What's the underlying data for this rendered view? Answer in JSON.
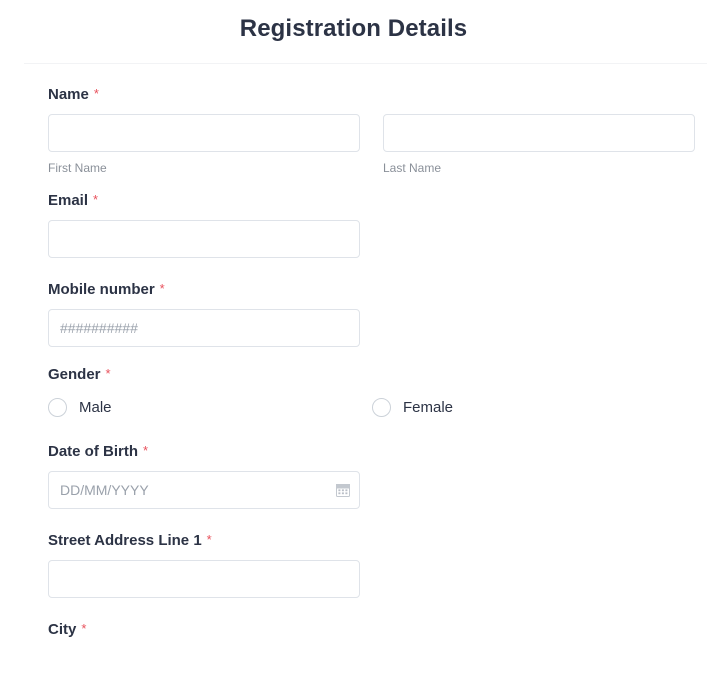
{
  "header": {
    "title": "Registration Details"
  },
  "required_marker": "*",
  "colors": {
    "required_asterisk": "#e8505b",
    "title": "#2c3345",
    "input_border": "#dfe3e9",
    "sub_label": "#8a9099",
    "placeholder": "#9aa1ab"
  },
  "fields": {
    "name": {
      "label": "Name",
      "required": true,
      "first": {
        "value": "",
        "placeholder": "",
        "sublabel": "First Name"
      },
      "last": {
        "value": "",
        "placeholder": "",
        "sublabel": "Last Name"
      }
    },
    "email": {
      "label": "Email",
      "required": true,
      "value": "",
      "placeholder": ""
    },
    "mobile": {
      "label": "Mobile number",
      "required": true,
      "value": "",
      "placeholder": "##########"
    },
    "gender": {
      "label": "Gender",
      "required": true,
      "options": [
        {
          "label": "Male",
          "selected": false
        },
        {
          "label": "Female",
          "selected": false
        }
      ]
    },
    "dob": {
      "label": "Date of Birth",
      "required": true,
      "value": "",
      "placeholder": "DD/MM/YYYY",
      "icon": "calendar-icon"
    },
    "street": {
      "label": "Street Address Line 1",
      "required": true,
      "value": "",
      "placeholder": ""
    },
    "city": {
      "label": "City",
      "required": true
    }
  }
}
